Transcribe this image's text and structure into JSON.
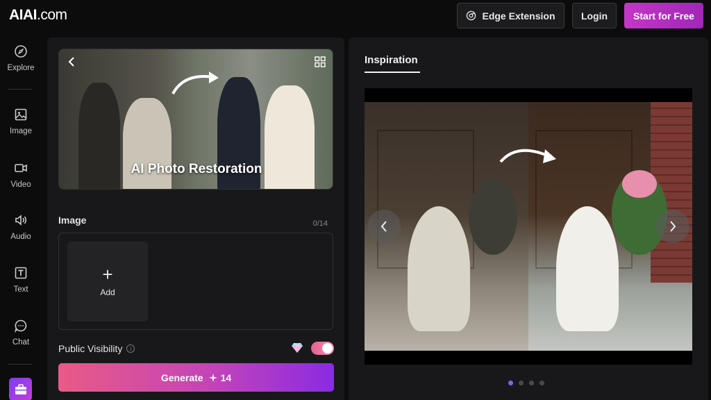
{
  "app": {
    "logo_text": "AIAI",
    "logo_domain": ".com"
  },
  "header": {
    "edge_label": "Edge Extension",
    "login_label": "Login",
    "start_label": "Start for Free"
  },
  "sidebar": {
    "items": [
      {
        "label": "Explore",
        "icon": "compass-icon"
      },
      {
        "label": "Image",
        "icon": "image-icon"
      },
      {
        "label": "Video",
        "icon": "video-icon"
      },
      {
        "label": "Audio",
        "icon": "speaker-icon"
      },
      {
        "label": "Text",
        "icon": "text-icon"
      },
      {
        "label": "Chat",
        "icon": "chat-icon"
      }
    ]
  },
  "tool": {
    "hero_title": "AI Photo Restoration",
    "image_label": "Image",
    "image_count": "0/14",
    "add_label": "Add",
    "visibility_label": "Public Visibility",
    "visibility_on": true,
    "generate_label": "Generate",
    "generate_cost": "14"
  },
  "inspiration": {
    "tab_label": "Inspiration",
    "slides_total": 4,
    "active_slide": 1
  },
  "colors": {
    "accent_gradient_start": "#e95a86",
    "accent_gradient_end": "#8a2be2",
    "start_button": "#b52fc0",
    "active_dot": "#8b5cf6"
  }
}
